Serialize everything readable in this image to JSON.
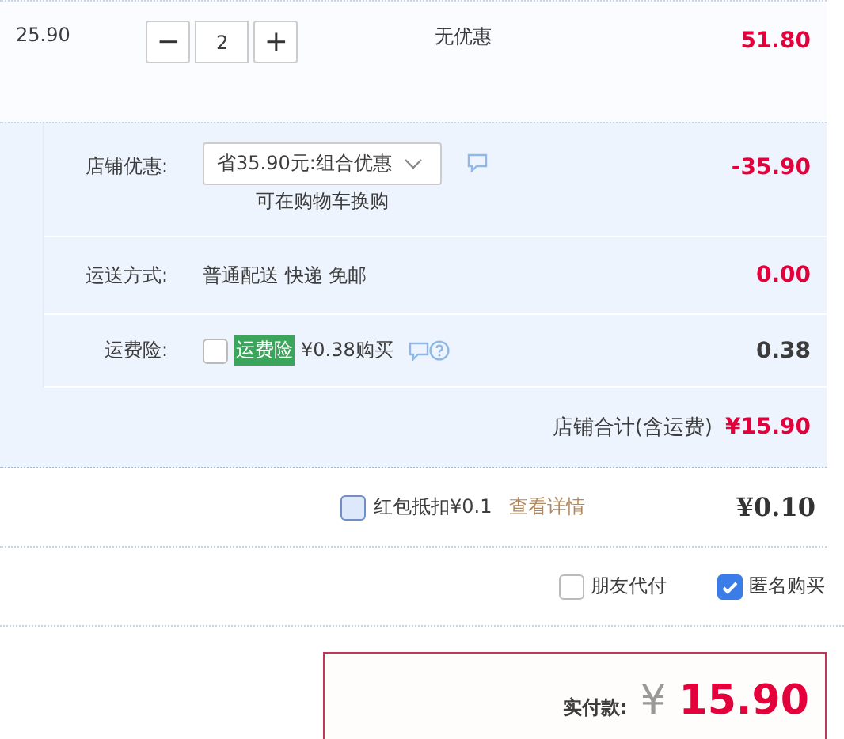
{
  "item": {
    "unit_price": "25.90",
    "decrement": "−",
    "quantity": "2",
    "increment": "+",
    "promotion": "无优惠",
    "subtotal": "51.80"
  },
  "shop": {
    "discount": {
      "label": "店铺优惠:",
      "selected_option": "省35.90元:组合优惠",
      "note": "可在购物车换购",
      "amount": "-35.90"
    },
    "shipping": {
      "label": "运送方式:",
      "method": "普通配送 快递 免邮",
      "amount": "0.00"
    },
    "insurance": {
      "label": "运费险:",
      "checked": false,
      "tag": "运费险",
      "offer": "¥0.38购买",
      "amount": "0.38"
    },
    "total": {
      "label": "店铺合计(含运费)",
      "amount": "¥15.90"
    }
  },
  "red_packet": {
    "checked": false,
    "label": "红包抵扣¥0.1",
    "link": "查看详情",
    "amount": "¥0.10"
  },
  "options": [
    {
      "label": "朋友代付",
      "checked": false
    },
    {
      "label": "匿名购买",
      "checked": true
    }
  ],
  "payment": {
    "label": "实付款:",
    "currency": "¥",
    "amount": "15.90"
  }
}
